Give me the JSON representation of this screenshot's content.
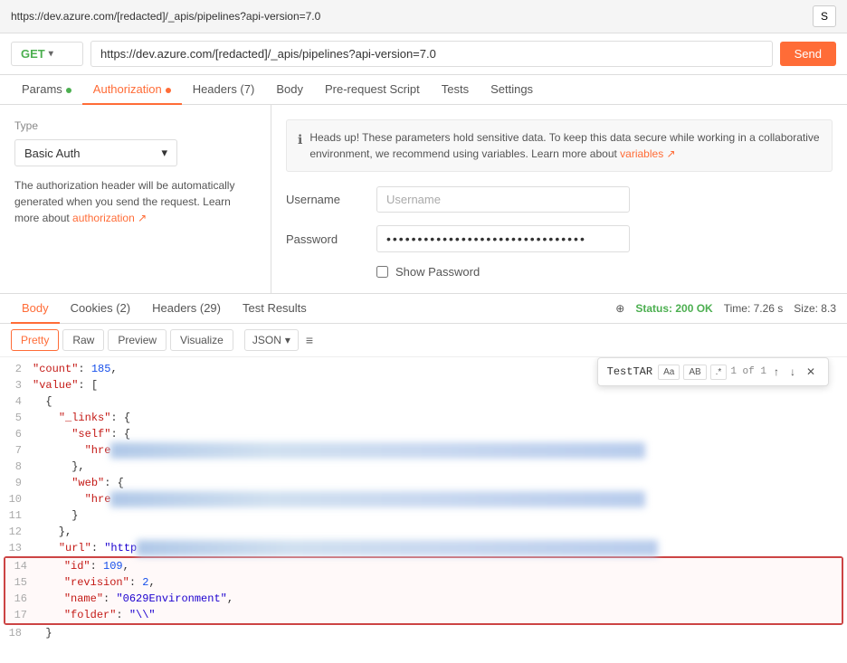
{
  "topbar": {
    "url": "https://dev.azure.com/[redacted]/_apis/pipelines?api-version=7.0",
    "save_label": "S"
  },
  "request": {
    "method": "GET",
    "url": "https://dev.azure.com/[redacted]/_apis/pipelines?api-version=7.0",
    "send_label": "Send"
  },
  "tabs": [
    {
      "id": "params",
      "label": "Params",
      "dot": "green"
    },
    {
      "id": "authorization",
      "label": "Authorization",
      "dot": "orange",
      "active": true
    },
    {
      "id": "headers",
      "label": "Headers (7)",
      "dot": null
    },
    {
      "id": "body",
      "label": "Body",
      "dot": null
    },
    {
      "id": "prerequest",
      "label": "Pre-request Script",
      "dot": null
    },
    {
      "id": "tests",
      "label": "Tests",
      "dot": null
    },
    {
      "id": "settings",
      "label": "Settings",
      "dot": null
    }
  ],
  "auth": {
    "type_label": "Type",
    "type_value": "Basic Auth",
    "desc": "The authorization header will be automatically generated when you send the request. Learn more about",
    "desc_link": "authorization ↗",
    "info_text": "Heads up! These parameters hold sensitive data. To keep this data secure while working in a collaborative environment, we recommend using variables. Learn more about",
    "info_link": "variables ↗",
    "username_label": "Username",
    "username_placeholder": "Username",
    "password_label": "Password",
    "password_value": "••••••••••••••••••••••••••••••••",
    "show_password_label": "Show Password"
  },
  "response_tabs": [
    {
      "id": "body",
      "label": "Body",
      "active": true
    },
    {
      "id": "cookies",
      "label": "Cookies (2)"
    },
    {
      "id": "headers",
      "label": "Headers (29)"
    },
    {
      "id": "testresults",
      "label": "Test Results"
    }
  ],
  "response_status": {
    "icon": "⊕",
    "status": "Status: 200 OK",
    "time": "Time: 7.26 s",
    "size": "Size: 8.3"
  },
  "viewer": {
    "buttons": [
      "Pretty",
      "Raw",
      "Preview",
      "Visualize"
    ],
    "active_btn": "Pretty",
    "format": "JSON",
    "wrap_icon": "≡"
  },
  "search": {
    "query": "TestTAR",
    "match": "1 of 1",
    "options": [
      "Aa",
      "AB",
      "*"
    ]
  },
  "code_lines": [
    {
      "num": 2,
      "content": "  \"count\": 185,"
    },
    {
      "num": 3,
      "content": "  \"value\": ["
    },
    {
      "num": 4,
      "content": "    {"
    },
    {
      "num": 5,
      "content": "      \"_links\": {"
    },
    {
      "num": 6,
      "content": "        \"self\": {"
    },
    {
      "num": 7,
      "content": "          \"hre",
      "blurred": true
    },
    {
      "num": 8,
      "content": "        },"
    },
    {
      "num": 9,
      "content": "        \"web\": {"
    },
    {
      "num": 10,
      "content": "          \"hre",
      "blurred": true
    },
    {
      "num": 11,
      "content": "        }"
    },
    {
      "num": 12,
      "content": "      },"
    },
    {
      "num": 13,
      "content": "      \"url\": \"http",
      "blurred_url": true
    },
    {
      "num": 14,
      "content": "      \"id\": 109,",
      "highlight": true
    },
    {
      "num": 15,
      "content": "      \"revision\": 2,",
      "highlight": true
    },
    {
      "num": 16,
      "content": "      \"name\": \"0629Environment\",",
      "highlight": true
    },
    {
      "num": 17,
      "content": "      \"folder\": \"\\\\\"",
      "highlight": true
    },
    {
      "num": 18,
      "content": "    }"
    }
  ]
}
